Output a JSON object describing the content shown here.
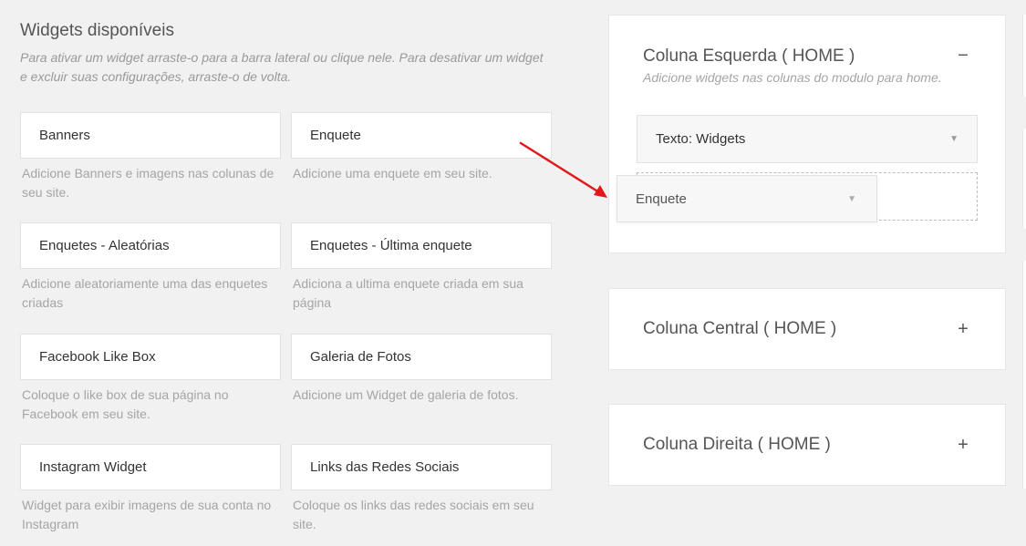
{
  "available": {
    "title": "Widgets disponíveis",
    "description": "Para ativar um widget arraste-o para a barra lateral ou clique nele. Para desativar um widget e excluir suas configurações, arraste-o de volta.",
    "widgets": [
      {
        "name": "Banners",
        "description": "Adicione Banners e imagens nas colunas de seu site."
      },
      {
        "name": "Enquete",
        "description": "Adicione uma enquete em seu site."
      },
      {
        "name": "Enquetes - Aleatórias",
        "description": "Adicione aleatoriamente uma das enquetes criadas"
      },
      {
        "name": "Enquetes - Última enquete",
        "description": "Adiciona a ultima enquete criada em sua página"
      },
      {
        "name": "Facebook Like Box",
        "description": "Coloque o like box de sua página no Facebook em seu site."
      },
      {
        "name": "Galeria de Fotos",
        "description": "Adicione um Widget de galeria de fotos."
      },
      {
        "name": "Instagram Widget",
        "description": "Widget para exibir imagens de sua conta no Instagram"
      },
      {
        "name": "Links das Redes Sociais",
        "description": "Coloque os links das redes sociais em seu site."
      }
    ]
  },
  "sidebars": {
    "left": {
      "title": "Coluna Esquerda ( HOME )",
      "description": "Adicione widgets nas colunas do modulo para home.",
      "toggle": "−",
      "placed_widget": "Texto: Widgets"
    },
    "center": {
      "title": "Coluna Central ( HOME )",
      "toggle": "+"
    },
    "right": {
      "title": "Coluna Direita ( HOME )",
      "toggle": "+"
    }
  },
  "dragging": {
    "name": "Enquete"
  },
  "icons": {
    "caret": "caret-down-icon",
    "arrow": "annotation-arrow-icon"
  },
  "colors": {
    "arrow": "#e3161b",
    "panel": "#ffffff",
    "background": "#f1f1f1"
  }
}
